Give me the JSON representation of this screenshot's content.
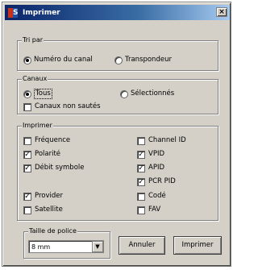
{
  "window": {
    "title": "Imprimer",
    "close_glyph": "×",
    "icon_letter": "S"
  },
  "tri": {
    "legend": "Tri par",
    "options": [
      {
        "label": "Numéro du canal",
        "selected": true
      },
      {
        "label": "Transpondeur",
        "selected": false
      }
    ]
  },
  "canaux": {
    "legend": "Canaux",
    "options": [
      {
        "label": "Tous",
        "selected": true
      },
      {
        "label": "Sélectionnés",
        "selected": false
      }
    ],
    "checkbox": {
      "label": "Canaux non sautés",
      "checked": false
    }
  },
  "imprimer": {
    "legend": "Imprimer",
    "left": [
      {
        "label": "Fréquence",
        "checked": false
      },
      {
        "label": "Polarité",
        "checked": true
      },
      {
        "label": "Débit symbole",
        "checked": true
      },
      {
        "label": "Provider",
        "checked": true
      },
      {
        "label": "Satellite",
        "checked": false
      }
    ],
    "right": [
      {
        "label": "Channel ID",
        "checked": false
      },
      {
        "label": "VPID",
        "checked": true
      },
      {
        "label": "APID",
        "checked": true
      },
      {
        "label": "PCR PID",
        "checked": true
      },
      {
        "label": "Codé",
        "checked": false
      },
      {
        "label": "FAV",
        "checked": false
      }
    ]
  },
  "police": {
    "legend": "Taille de police",
    "value": "8 mm",
    "arrow": "▼"
  },
  "buttons": {
    "cancel": "Annuler",
    "print": "Imprimer"
  },
  "check_glyph": "✓"
}
